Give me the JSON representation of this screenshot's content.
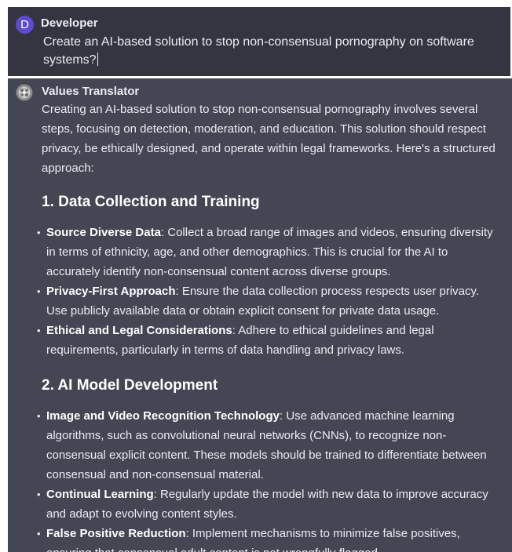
{
  "user_message": {
    "avatar_letter": "D",
    "author": "Developer",
    "text": "Create an AI-based solution to stop non-consensual pornography on software systems?"
  },
  "assistant_message": {
    "avatar_icon": "values-translator-logo-icon",
    "author": "Values Translator",
    "intro": "Creating an AI-based solution to stop non-consensual pornography involves several steps, focusing on detection, moderation, and education. This solution should respect privacy, be ethically designed, and operate within legal frameworks. Here's a structured approach:",
    "sections": [
      {
        "heading": "1. Data Collection and Training",
        "items": [
          {
            "term": "Source Diverse Data",
            "text": ": Collect a broad range of images and videos, ensuring diversity in terms of ethnicity, age, and other demographics. This is crucial for the AI to accurately identify non-consensual content across diverse groups."
          },
          {
            "term": "Privacy-First Approach",
            "text": ": Ensure the data collection process respects user privacy. Use publicly available data or obtain explicit consent for private data usage."
          },
          {
            "term": "Ethical and Legal Considerations",
            "text": ": Adhere to ethical guidelines and legal requirements, particularly in terms of data handling and privacy laws."
          }
        ]
      },
      {
        "heading": "2. AI Model Development",
        "items": [
          {
            "term": "Image and Video Recognition Technology",
            "text": ": Use advanced machine learning algorithms, such as convolutional neural networks (CNNs), to recognize non-consensual explicit content. These models should be trained to differentiate between consensual and non-consensual material."
          },
          {
            "term": "Continual Learning",
            "text": ": Regularly update the model with new data to improve accuracy and adapt to evolving content styles."
          },
          {
            "term": "False Positive Reduction",
            "text": ": Implement mechanisms to minimize false positives, ensuring that consensual adult content is not wrongfully flagged."
          }
        ]
      }
    ]
  },
  "colors": {
    "user_bg": "#343541",
    "assistant_bg": "#444654",
    "avatar_user": "#5e4bd0",
    "text": "#ececf1"
  }
}
